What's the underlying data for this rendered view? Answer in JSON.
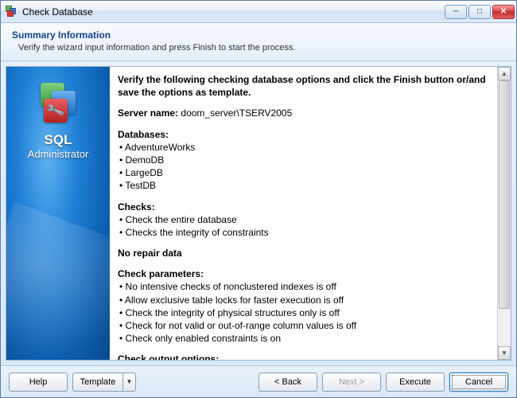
{
  "window": {
    "title": "Check Database"
  },
  "header": {
    "title": "Summary Information",
    "subtitle": "Verify the wizard input information and press Finish to start the process."
  },
  "sidebar": {
    "line1": "SQL",
    "line2": "Administrator"
  },
  "summary": {
    "instruction": "Verify the following checking database options and click the Finish button or/and save the options as template.",
    "server_label": "Server name:",
    "server_value": "doom_server\\TSERV2005",
    "databases_label": "Databases:",
    "databases": [
      "AdventureWorks",
      "DemoDB",
      "LargeDB",
      "TestDB"
    ],
    "checks_label": "Checks:",
    "checks": [
      "Check the entire database",
      "Checks the integrity of constraints"
    ],
    "no_repair": "No repair data",
    "params_label": "Check parameters:",
    "params": [
      "No intensive checks of nonclustered indexes is off",
      "Allow exclusive table locks for faster execution is off",
      "Check the integrity of physical structures only is off",
      "Check for not valid or out-of-range column values is off",
      "Check only enabled constraints is on"
    ],
    "output_label": "Check output options:"
  },
  "buttons": {
    "help": "Help",
    "template": "Template",
    "back": "< Back",
    "next": "Next >",
    "execute": "Execute",
    "cancel": "Cancel"
  }
}
